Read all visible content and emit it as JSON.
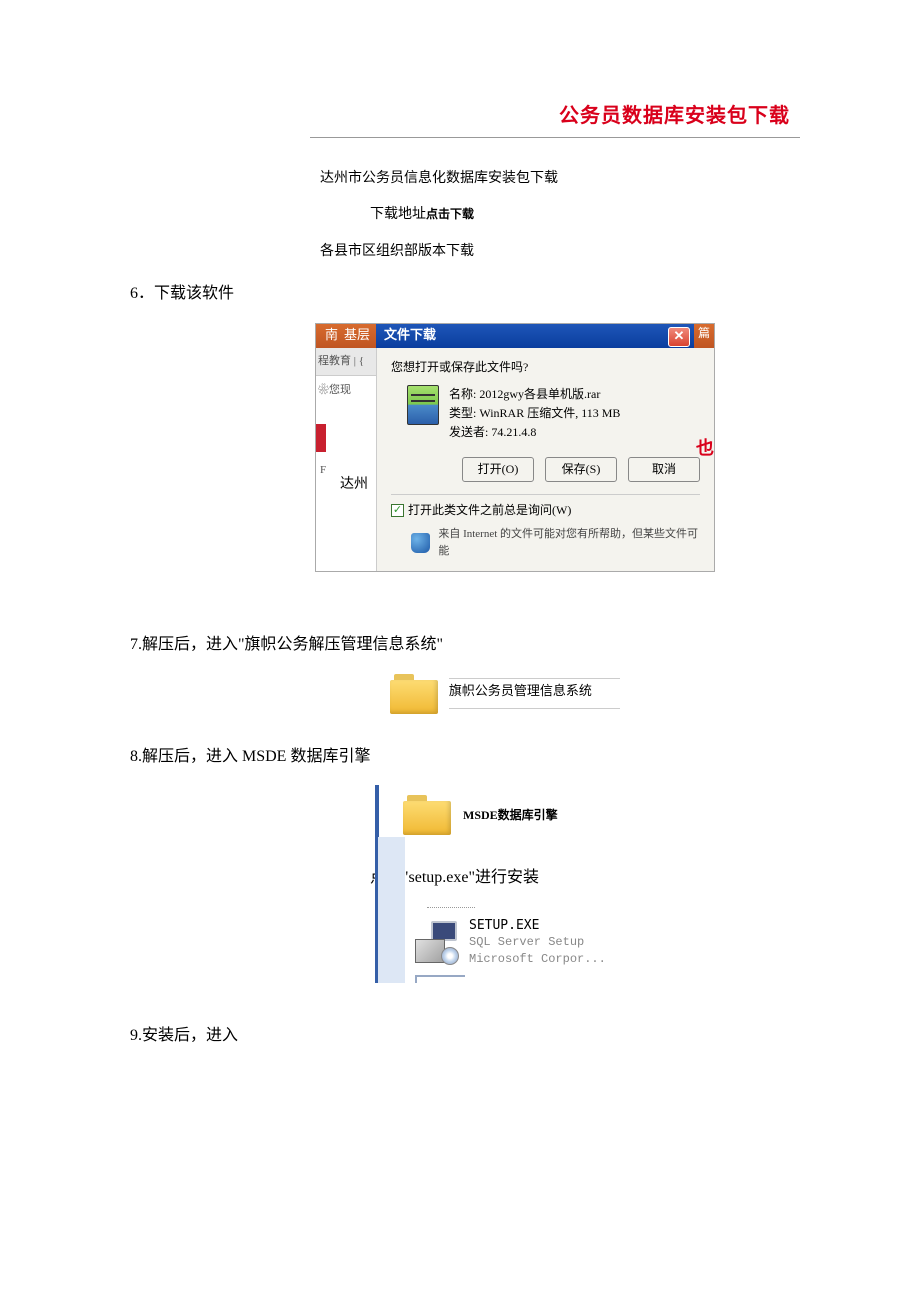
{
  "headerTitle": "公务员数据库安装包下载",
  "intro": {
    "line1": "达州市公务员信息化数据库安装包下载",
    "downloadLabel": "下载地址",
    "downloadLink": "点击下载",
    "line2": "各县市区组织部版本下载"
  },
  "steps": {
    "s6": "6．下载该软件",
    "s7": "7.解压后，进入\"旗帜公务解压管理信息系统\"",
    "s8": "8.解压后，进入 MSDE 数据库引擎",
    "s8b": "点击\"setup.exe\"进行安装",
    "s9": "9.安装后，进入"
  },
  "dialog": {
    "title": "文件下载",
    "navLeft1": "南",
    "navLeft2": "基层",
    "navSub": "程教育 | {",
    "navNote": "❀您现",
    "navBottom": "F",
    "navDazhou": "达州",
    "prompt": "您想打开或保存此文件吗?",
    "meta": {
      "nameLabel": "名称:",
      "nameVal": "2012gwy各县单机版.rar",
      "typeLabel": "类型:",
      "typeVal": "WinRAR 压缩文件, 113 MB",
      "fromLabel": "发送者:",
      "fromVal": "74.21.4.8"
    },
    "buttons": {
      "open": "打开(O)",
      "save": "保存(S)",
      "cancel": "取消"
    },
    "checkboxLabel": "打开此类文件之前总是询问(W)",
    "infoText": "来自 Internet 的文件可能对您有所帮助，但某些文件可能",
    "rightHint": "也",
    "rightStrip": "篇"
  },
  "folder7": {
    "label": "旗帜公务员管理信息系统"
  },
  "folder8": {
    "label": "MSDE数据库引擎"
  },
  "setup": {
    "filename": "SETUP.EXE",
    "line2": "SQL Server Setup",
    "line3": "Microsoft Corpor..."
  }
}
